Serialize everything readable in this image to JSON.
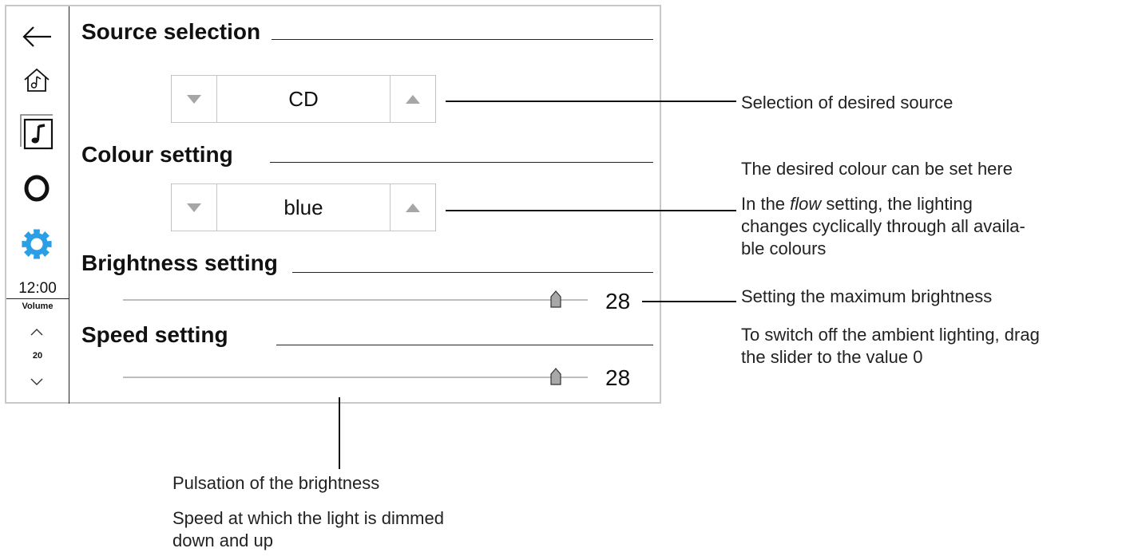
{
  "sidebar": {
    "back_icon": "arrow-left-icon",
    "home_icon": "home-music-icon",
    "media_icon": "music-note-icon",
    "ambient_icon": "ring-icon",
    "settings_icon": "gear-icon",
    "settings_color": "#2a9fe6",
    "clock": "12:00",
    "volume_label": "Volume",
    "volume_value": "20"
  },
  "sections": {
    "source": {
      "title": "Source selection",
      "value": "CD"
    },
    "colour": {
      "title": "Colour setting",
      "value": "blue"
    },
    "brightness": {
      "title": "Brightness setting",
      "value": "28"
    },
    "speed": {
      "title": "Speed setting",
      "value": "28"
    }
  },
  "callouts": {
    "source": "Selection of desired source",
    "colour_1": "The desired colour can be set here",
    "colour_2_pre": "In the ",
    "colour_2_em": "flow",
    "colour_2_post": " setting, the lighting",
    "colour_3": "changes cyclically through all availa-",
    "colour_4": "ble colours",
    "brightness_1": "Setting the maximum brightness",
    "brightness_2": "To switch off the ambient lighting, drag",
    "brightness_3": "the slider to the value 0",
    "speed_1": "Pulsation of the brightness",
    "speed_2": "Speed at which the light is dimmed",
    "speed_3": "down and up"
  }
}
